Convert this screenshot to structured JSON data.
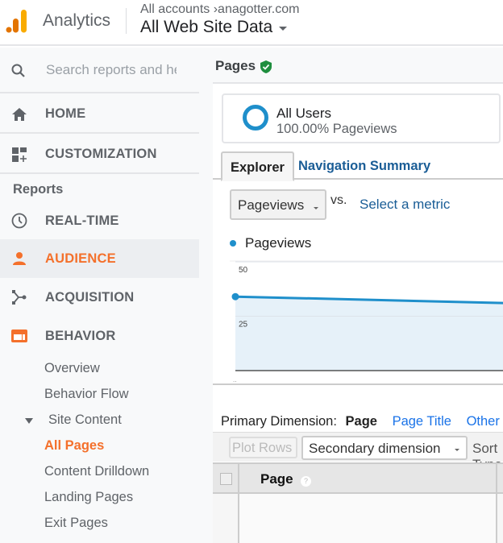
{
  "header": {
    "app_name": "Analytics",
    "breadcrumb_root": "All accounts",
    "breadcrumb_sep": "›",
    "breadcrumb_account": "anagotter.com",
    "view_name": "All Web Site Data",
    "logo_colors": [
      "#e37400",
      "#f9ab00"
    ]
  },
  "sidebar": {
    "search_placeholder": "Search reports and help",
    "items": [
      {
        "label": "HOME",
        "icon": "home-icon"
      },
      {
        "label": "CUSTOMIZATION",
        "icon": "dashboard-plus-icon"
      }
    ],
    "reports_label": "Reports",
    "report_items": [
      {
        "label": "REAL-TIME",
        "icon": "clock-icon",
        "active": false
      },
      {
        "label": "AUDIENCE",
        "icon": "person-icon",
        "active": true
      },
      {
        "label": "ACQUISITION",
        "icon": "acquisition-fork-icon",
        "active": false
      },
      {
        "label": "BEHAVIOR",
        "icon": "behavior-window-icon",
        "active": false
      }
    ],
    "behavior_sub": [
      "Overview",
      "Behavior Flow"
    ],
    "site_content_label": "Site Content",
    "site_content_items": [
      "All Pages",
      "Content Drilldown",
      "Landing Pages",
      "Exit Pages"
    ],
    "active_sub": "All Pages",
    "accent_color": "#f4702b"
  },
  "main": {
    "page_title": "Pages",
    "segment": {
      "name": "All Users",
      "sub": "100.00% Pageviews"
    },
    "tabs": [
      {
        "label": "Explorer",
        "active": true
      },
      {
        "label": "Navigation Summary",
        "active": false
      }
    ],
    "metric_select": "Pageviews",
    "vs_label": "vs.",
    "select_metric_label": "Select a metric",
    "legend_label": "Pageviews",
    "primary_dimension_label": "Primary Dimension:",
    "primary_dimension_current": "Page",
    "primary_dimension_links": [
      "Page Title",
      "Other"
    ],
    "plot_rows_label": "Plot Rows",
    "secondary_dimension_label": "Secondary dimension",
    "sort_label": "Sort Type",
    "table_header": {
      "page": "Page",
      "help": "?"
    }
  },
  "chart_data": {
    "type": "area",
    "title": "",
    "series": [
      {
        "name": "Pageviews",
        "values": [
          34,
          31
        ],
        "color": "#1f8fcb"
      }
    ],
    "x": [
      "..",
      ""
    ],
    "y_ticks": [
      "25",
      "50"
    ],
    "ylim": [
      0,
      50
    ],
    "x_tick_label": "..",
    "grid": true,
    "legend": "top-left"
  }
}
